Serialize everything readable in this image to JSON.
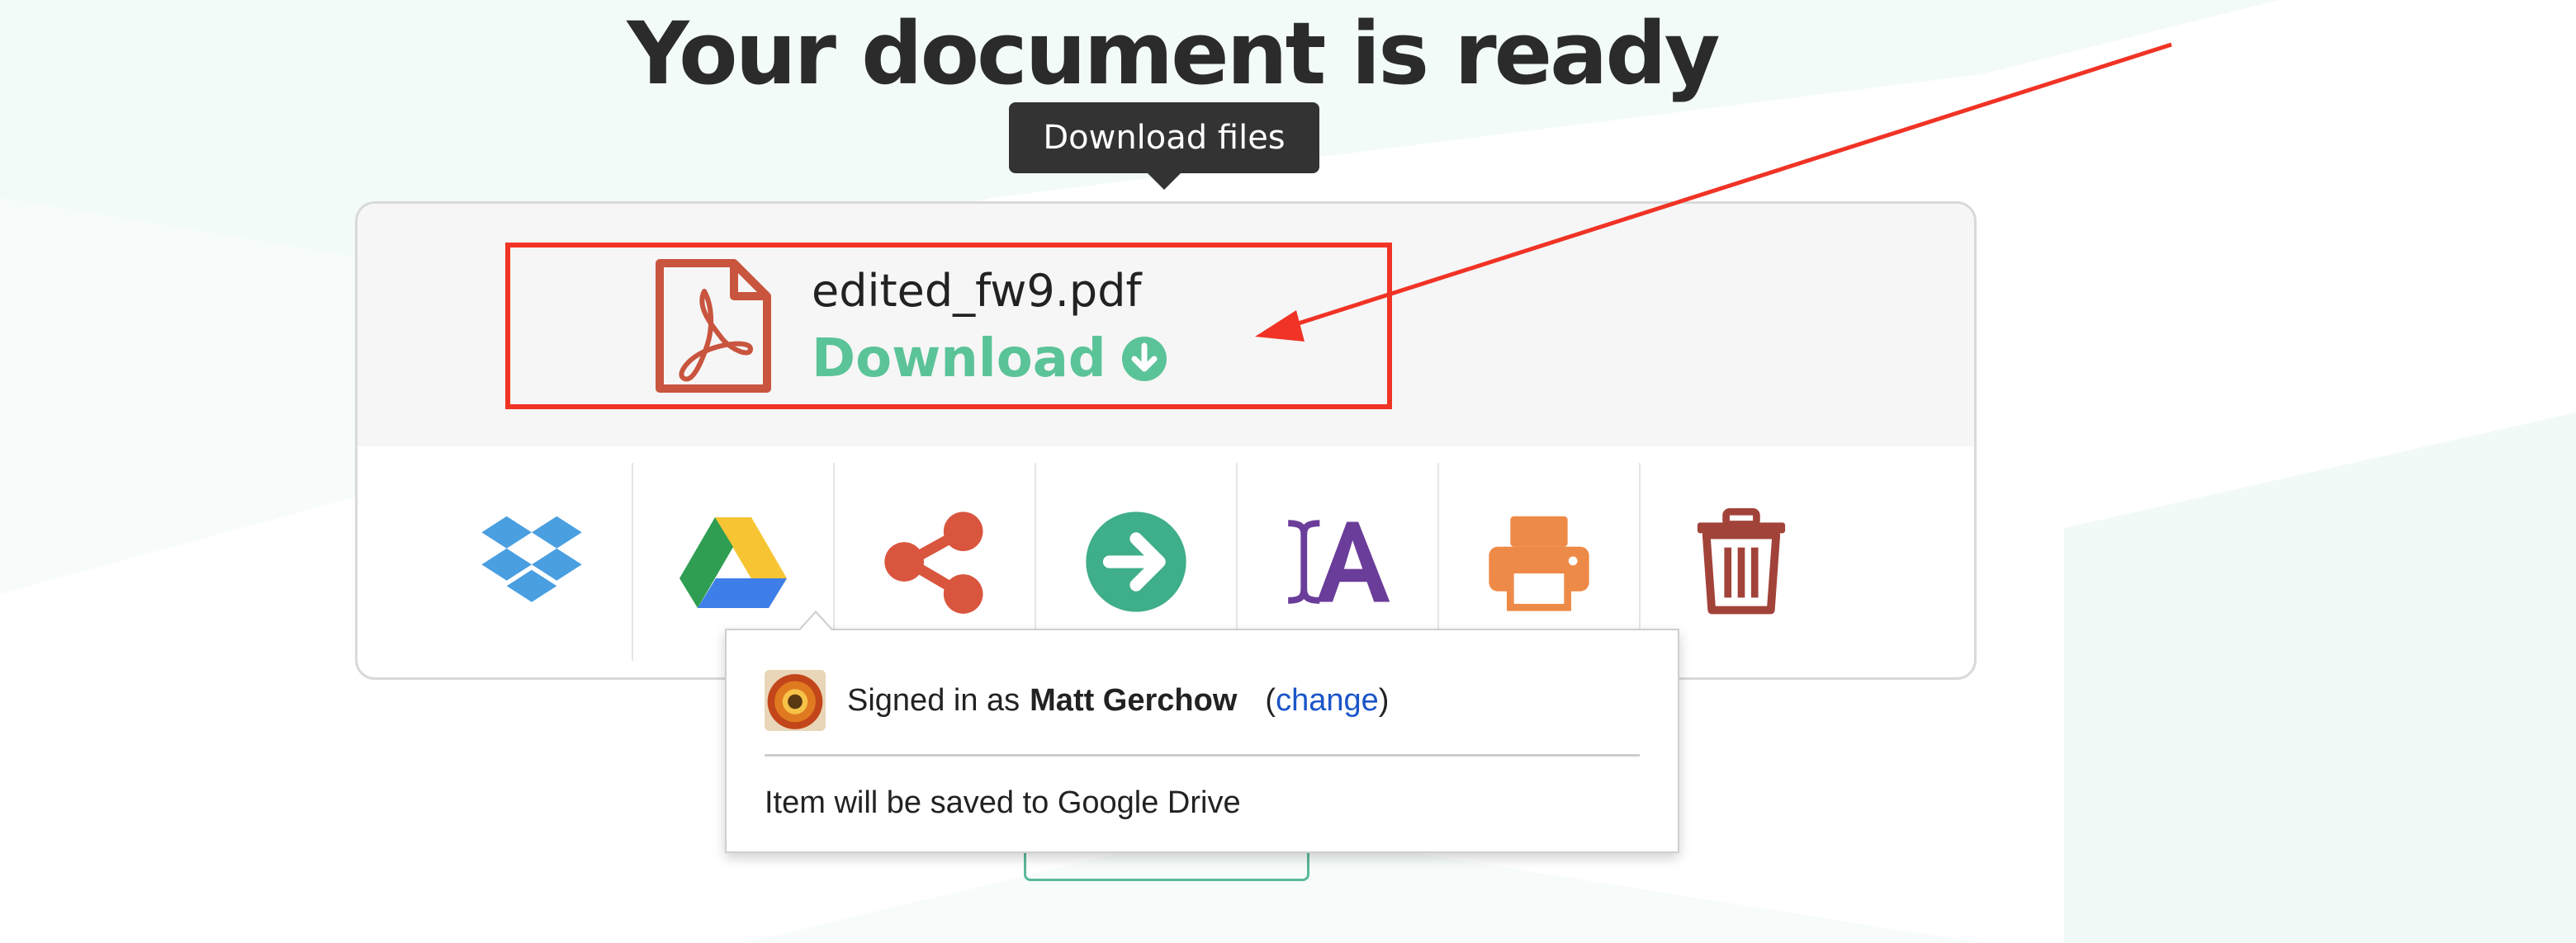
{
  "page": {
    "title": "Your document is ready"
  },
  "tooltip": {
    "label": "Download files"
  },
  "file": {
    "name": "edited_fw9.pdf",
    "download_label": "Download"
  },
  "actions": [
    {
      "icon": "dropbox-icon",
      "color": "#4a9fe0"
    },
    {
      "icon": "google-drive-icon",
      "color": "#2f9e52"
    },
    {
      "icon": "share-icon",
      "color": "#d9553e"
    },
    {
      "icon": "arrow-right-icon",
      "color": "#3fae8a"
    },
    {
      "icon": "font-edit-icon",
      "color": "#6b3d9a"
    },
    {
      "icon": "printer-icon",
      "color": "#ee8a48"
    },
    {
      "icon": "trash-icon",
      "color": "#a2433a"
    }
  ],
  "drive_popup": {
    "signed_in_prefix": "Signed in as",
    "user_name": "Matt Gerchow",
    "change_open": "(",
    "change_label": "change",
    "change_close": ")",
    "save_message": "Item will be saved to Google Drive"
  },
  "colors": {
    "accent_green": "#5bc398",
    "pdf_red": "#c9553f",
    "annotation_red": "#f03325",
    "link_blue": "#1a55c8"
  }
}
